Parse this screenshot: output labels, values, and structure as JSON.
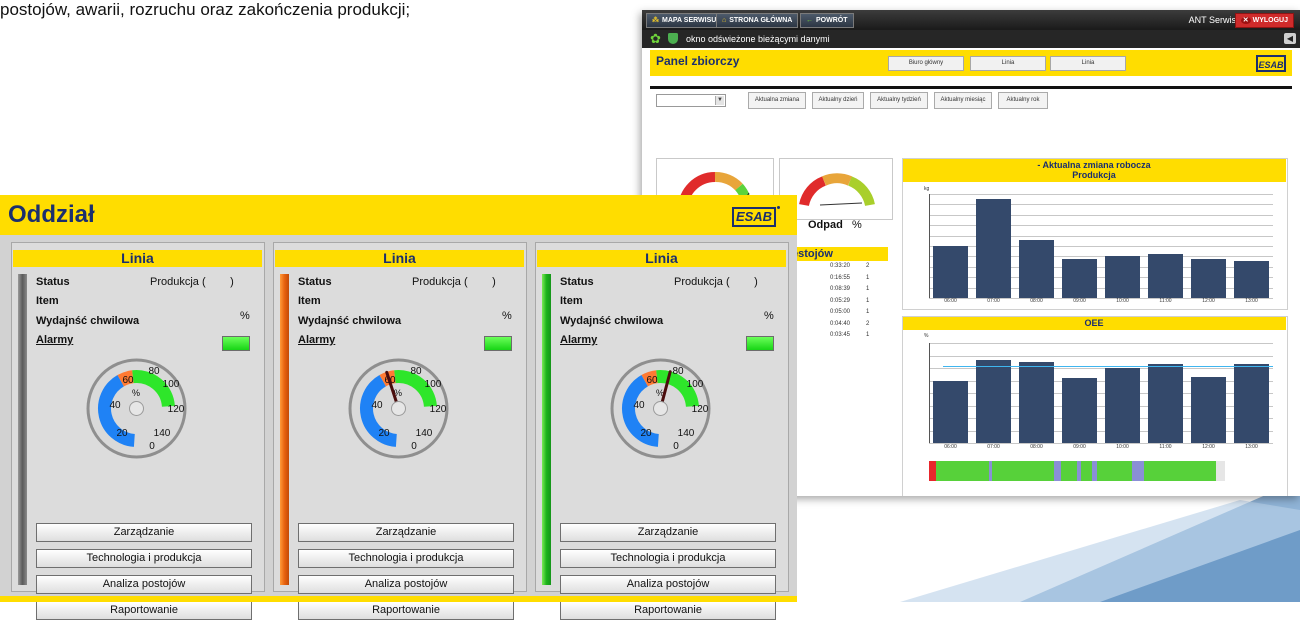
{
  "caption": "postojów, awarii, rozruchu oraz zakończenia produkcji;",
  "back_window": {
    "toolbar": {
      "map_btn": "MAPA SERWISU",
      "home_btn": "STRONA GŁÓWNA",
      "back_btn": "POWRÓT",
      "user": "ANT Serwis",
      "logout": "WYLOGUJ"
    },
    "status_msg": "okno odświeżone bieżącymi danymi",
    "panel_title": "Panel zbiorczy",
    "tabs": [
      "Biuro główny",
      "Linia",
      "Linia"
    ],
    "period_buttons": [
      "Aktualna zmiana",
      "Aktualny dzień",
      "Aktualny tydzień",
      "Aktualny miesiąc",
      "Aktualny rok"
    ],
    "gauge_label": "Odpad",
    "gauge_unit": "%",
    "downtime_title": "estojów",
    "downtime_rows": [
      [
        "0:33:20",
        "2"
      ],
      [
        "0:16:55",
        "1"
      ],
      [
        "0:08:39",
        "1"
      ],
      [
        "0:05:29",
        "1"
      ],
      [
        "0:05:00",
        "1"
      ],
      [
        "0:04:40",
        "2"
      ],
      [
        "0:03:45",
        "1"
      ]
    ],
    "production_title_line1": "- Aktualna zmiana robocza",
    "production_title_line2": "Produkcja",
    "production_unit": "kg",
    "oee_title": "OEE",
    "oee_unit": "%",
    "hours": [
      "06:00",
      "07:00",
      "08:00",
      "09:00",
      "10:00",
      "11:00",
      "12:00",
      "13:00"
    ],
    "status_strip": [
      [
        "#e8272c",
        0.02
      ],
      [
        "#57d13a",
        0.155
      ],
      [
        "#8a8fd6",
        0.008
      ],
      [
        "#57d13a",
        0.18
      ],
      [
        "#8a8fd6",
        0.022
      ],
      [
        "#57d13a",
        0.045
      ],
      [
        "#8a8fd6",
        0.012
      ],
      [
        "#57d13a",
        0.032
      ],
      [
        "#8a8fd6",
        0.015
      ],
      [
        "#57d13a",
        0.1
      ],
      [
        "#8a8fd6",
        0.036
      ],
      [
        "#57d13a",
        0.21
      ],
      [
        "#e6e6e6",
        0.025
      ]
    ]
  },
  "chart_data": [
    {
      "type": "bar",
      "title": "- Aktualna zmiana robocza Produkcja",
      "ylabel": "kg",
      "categories": [
        "06:00",
        "07:00",
        "08:00",
        "09:00",
        "10:00",
        "11:00",
        "12:00",
        "13:00"
      ],
      "values": [
        55,
        105,
        61,
        41,
        44,
        47,
        41,
        39
      ],
      "ylim": [
        0,
        110
      ],
      "grid": true,
      "color": "#34496b"
    },
    {
      "type": "bar",
      "title": "OEE",
      "ylabel": "%",
      "categories": [
        "06:00",
        "07:00",
        "08:00",
        "09:00",
        "10:00",
        "11:00",
        "12:00",
        "13:00"
      ],
      "values": [
        62,
        83,
        81,
        65,
        75,
        79,
        66,
        79
      ],
      "ylim": [
        0,
        100
      ],
      "reference_line": 77,
      "grid": true,
      "color": "#34496b"
    }
  ],
  "front_panel": {
    "title": "Oddział",
    "logo": "ESAB",
    "lines": [
      {
        "title": "Linia",
        "bar_color": "gray",
        "status_label": "Status",
        "status_value": "Produkcja (        )",
        "item_label": "Item",
        "efficiency_label": "Wydajnść chwilowa",
        "efficiency_unit": "%",
        "alarms_label": "Alarmy",
        "gauge_value_pct": 0,
        "gauge_ticks": [
          "0",
          "20",
          "40",
          "60",
          "80",
          "100",
          "120",
          "140"
        ],
        "gauge_unit": "%",
        "buttons": [
          "Zarządzanie",
          "Technologia i produkcja",
          "Analiza postojów",
          "Raportowanie"
        ]
      },
      {
        "title": "Linia",
        "bar_color": "orange",
        "status_label": "Status",
        "status_value": "Produkcja (        )",
        "item_label": "Item",
        "efficiency_label": "Wydajnść chwilowa",
        "efficiency_unit": "%",
        "alarms_label": "Alarmy",
        "gauge_value_pct": 84,
        "gauge_ticks": [
          "0",
          "20",
          "40",
          "60",
          "80",
          "100",
          "120",
          "140"
        ],
        "gauge_unit": "%",
        "buttons": [
          "Zarządzanie",
          "Technologia i produkcja",
          "Analiza postojów",
          "Raportowanie"
        ]
      },
      {
        "title": "Linia",
        "bar_color": "green",
        "status_label": "Status",
        "status_value": "Produkcja (        )",
        "item_label": "Item",
        "efficiency_label": "Wydajnść chwilowa",
        "efficiency_unit": "%",
        "alarms_label": "Alarmy",
        "gauge_value_pct": 101,
        "gauge_ticks": [
          "0",
          "20",
          "40",
          "60",
          "80",
          "100",
          "120",
          "140"
        ],
        "gauge_unit": "%",
        "buttons": [
          "Zarządzanie",
          "Technologia i produkcja",
          "Analiza postojów",
          "Raportowanie"
        ]
      }
    ]
  }
}
